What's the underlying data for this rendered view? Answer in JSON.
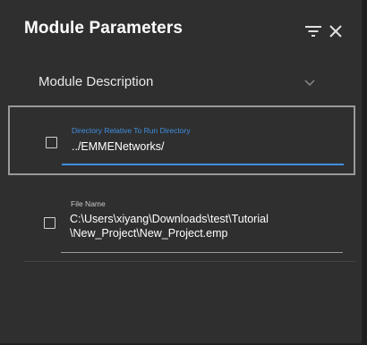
{
  "panel": {
    "title": "Module Parameters",
    "filter_icon": "filter-icon",
    "close_icon": "close-icon"
  },
  "section": {
    "label": "Module Description",
    "expanded": false
  },
  "parameters": [
    {
      "label": "Directory Relative To Run Directory",
      "value": "../EMMENetworks/",
      "checked": false,
      "focused": true
    },
    {
      "label": "File Name",
      "value": "C:\\Users\\xiyang\\Downloads\\test\\Tutorial\\New_Project\\New_Project.emp",
      "value_line1": "C:\\Users\\xiyang\\Downloads\\test\\Tutorial",
      "value_line2": "\\New_Project\\New_Project.emp",
      "checked": false,
      "focused": false
    }
  ],
  "colors": {
    "panel_bg": "#2f2f2f",
    "accent": "#3f8fe0",
    "text": "#ffffff",
    "focus_border": "#9a9a9a"
  }
}
